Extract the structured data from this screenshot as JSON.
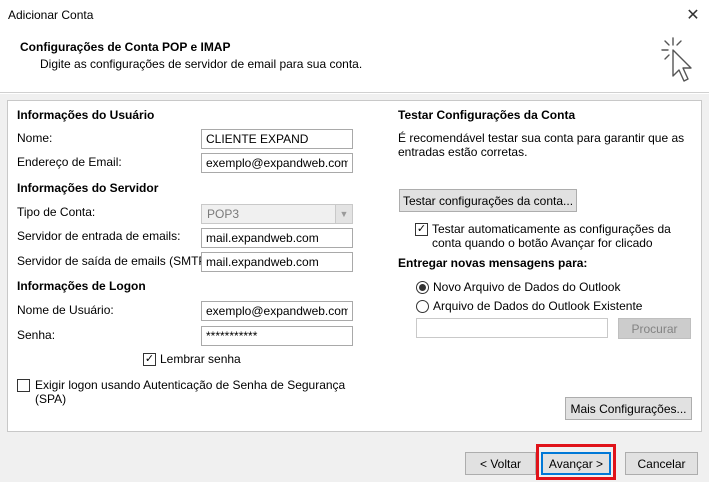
{
  "window": {
    "title": "Adicionar Conta",
    "close_glyph": "✕"
  },
  "header": {
    "title": "Configurações de Conta POP e IMAP",
    "subtitle": "Digite as configurações de servidor de email para sua conta.",
    "icon": "cursor-click-icon"
  },
  "user_info": {
    "heading": "Informações do Usuário",
    "name_label": "Nome:",
    "name_value": "CLIENTE EXPAND",
    "email_label": "Endereço de Email:",
    "email_value": "exemplo@expandweb.com"
  },
  "server_info": {
    "heading": "Informações do Servidor",
    "account_type_label": "Tipo de Conta:",
    "account_type_value": "POP3",
    "incoming_label": "Servidor de entrada de emails:",
    "incoming_value": "mail.expandweb.com",
    "outgoing_label": "Servidor de saída de emails (SMTP):",
    "outgoing_value": "mail.expandweb.com"
  },
  "logon_info": {
    "heading": "Informações de Logon",
    "username_label": "Nome de Usuário:",
    "username_value": "exemplo@expandweb.com",
    "password_label": "Senha:",
    "password_value": "***********",
    "remember_label": "Lembrar senha",
    "remember_checked": true,
    "spa_label_line1": "Exigir logon usando Autenticação de Senha de Segurança",
    "spa_label_line2": "(SPA)",
    "spa_checked": false
  },
  "test_settings": {
    "heading": "Testar Configurações da Conta",
    "description_line1": "É recomendável testar sua conta para garantir que as",
    "description_line2": "entradas estão corretas.",
    "test_button": "Testar configurações da conta...",
    "auto_test_line1": "Testar automaticamente as configurações da",
    "auto_test_line2": "conta quando o botão Avançar for clicado",
    "auto_test_checked": true
  },
  "delivery": {
    "heading": "Entregar novas mensagens para:",
    "option_new": "Novo Arquivo de Dados do Outlook",
    "option_existing": "Arquivo de Dados do Outlook Existente",
    "selected": "new",
    "path_value": "",
    "browse_button": "Procurar"
  },
  "more_settings_button": "Mais Configurações...",
  "footer": {
    "back_button": "< Voltar",
    "next_button": "Avançar >",
    "cancel_button": "Cancelar"
  },
  "colors": {
    "highlight": "#e0131a",
    "default_button_border": "#0078d7",
    "panel_background": "#f0f0f0"
  }
}
